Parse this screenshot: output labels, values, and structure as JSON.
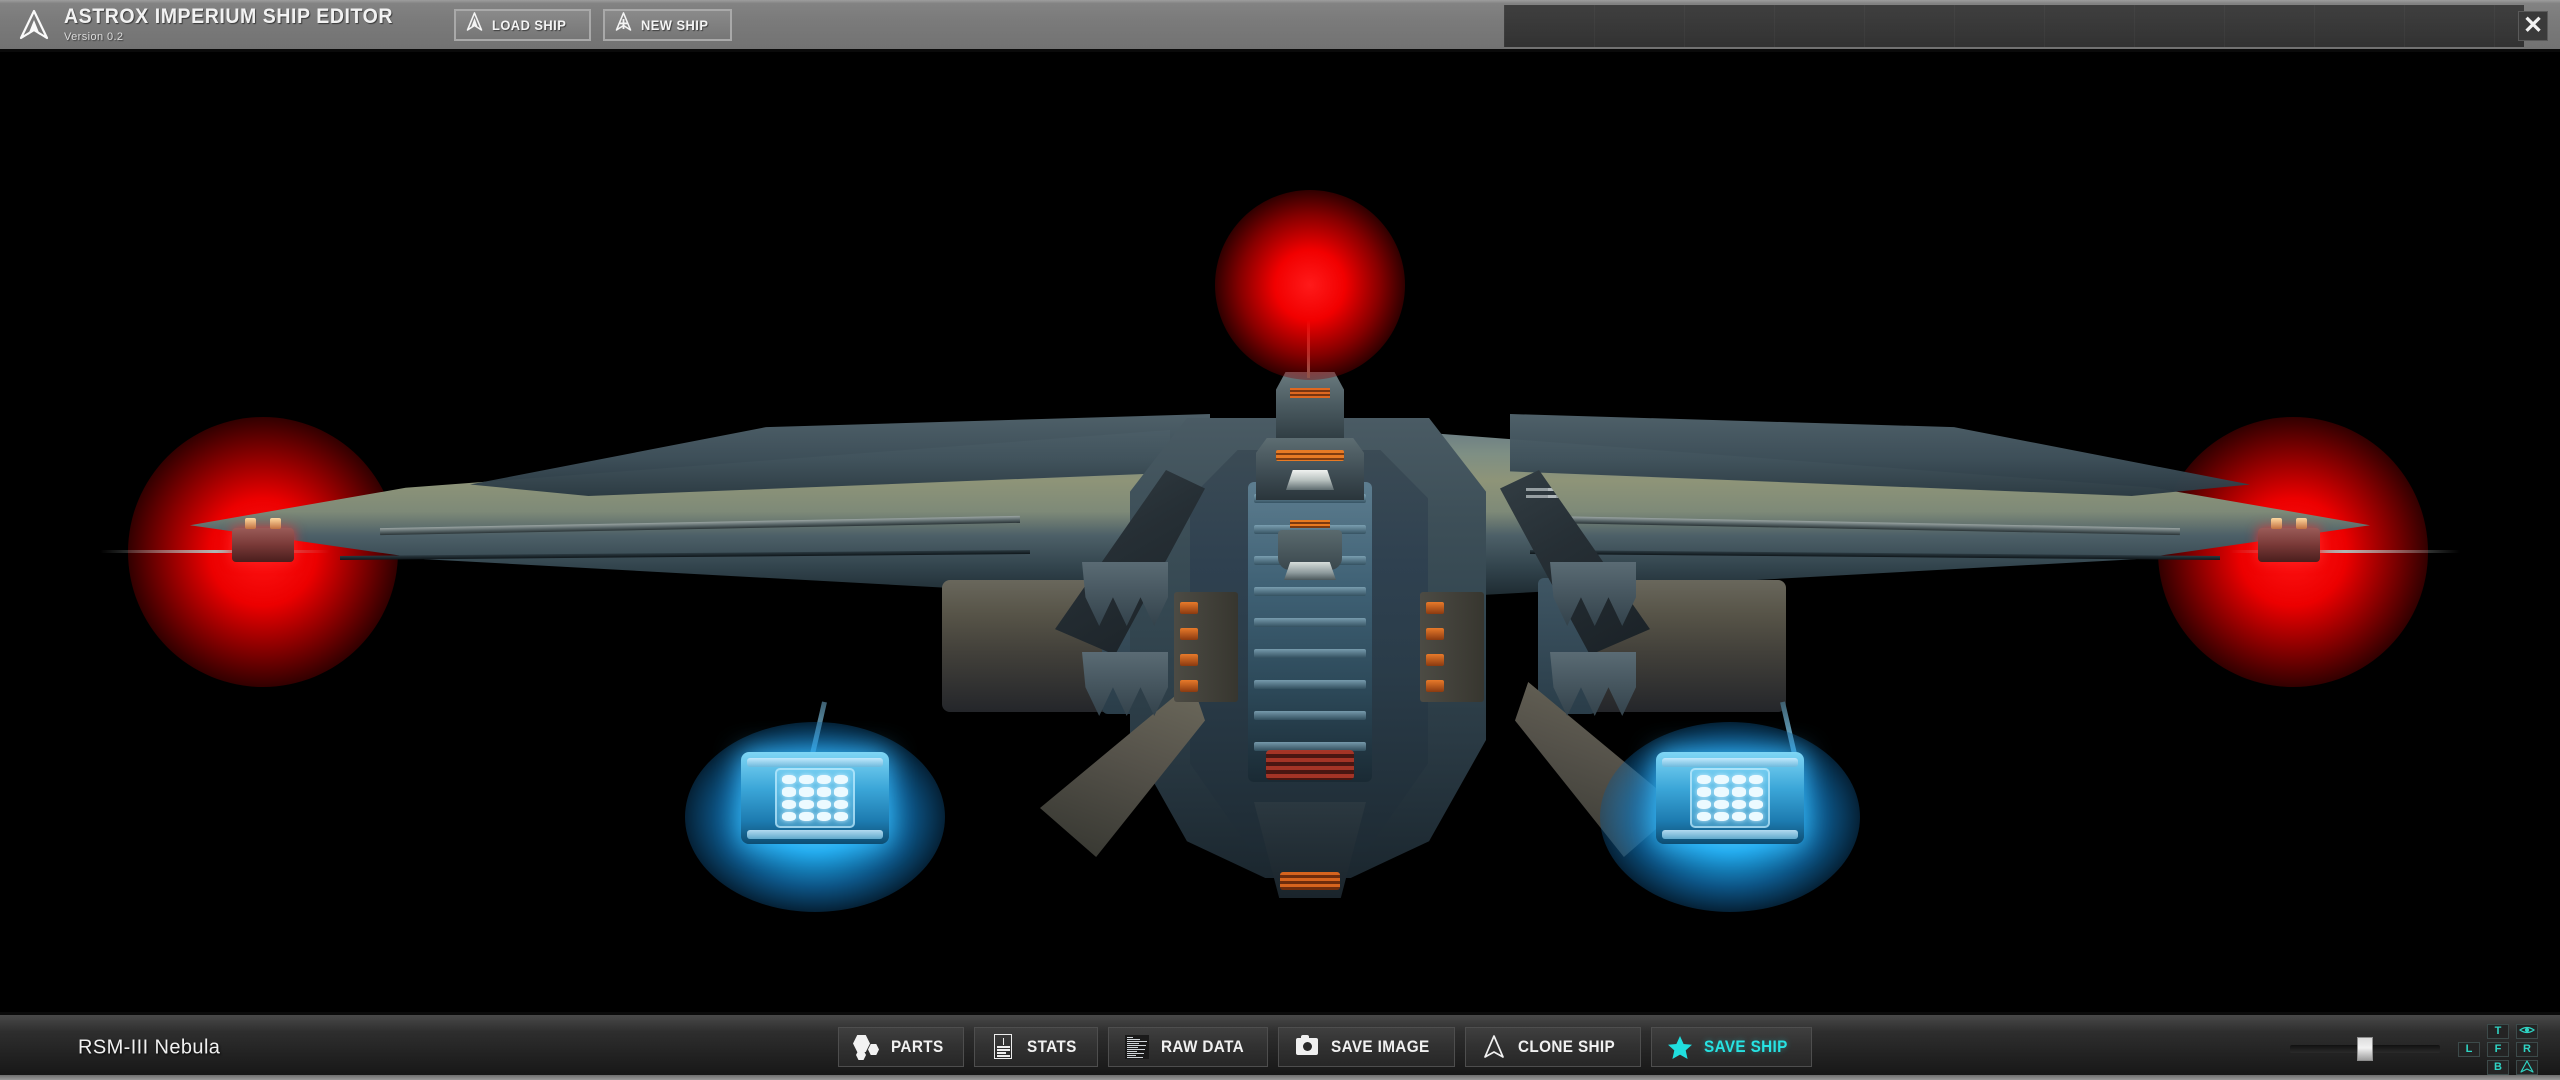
{
  "header": {
    "logo_icon": "astrox-arrow-logo-icon",
    "title": "ASTROX IMPERIUM SHIP EDITOR",
    "version": "Version 0.2",
    "buttons": [
      {
        "label": "LOAD SHIP",
        "icon": "arrow-up-outline-icon"
      },
      {
        "label": "NEW SHIP",
        "icon": "arrow-up-plus-icon"
      }
    ],
    "close_label": "✕"
  },
  "viewport": {
    "background_color": "#000000",
    "model_name": "RSM-III Nebula",
    "lights": {
      "red_glow_color": "#ec0000",
      "blue_thruster_color": "#1ea6e8",
      "red_glow_count": 3,
      "blue_glow_count": 2
    },
    "hull_colors": {
      "wing_upper": "#8e9478",
      "wing_lower": "#1b272d",
      "core": "#334650",
      "accent_orange": "#e87a24",
      "accent_blue": "#3f6175"
    }
  },
  "footer": {
    "ship_name": "RSM-III Nebula",
    "actions": [
      {
        "label": "PARTS",
        "icon": "hexagons-icon",
        "accent": false
      },
      {
        "label": "STATS",
        "icon": "document-info-icon",
        "accent": false
      },
      {
        "label": "RAW DATA",
        "icon": "text-block-icon",
        "accent": false
      },
      {
        "label": "SAVE IMAGE",
        "icon": "camera-icon",
        "accent": false
      },
      {
        "label": "CLONE SHIP",
        "icon": "arrow-up-outline-icon",
        "accent": false
      },
      {
        "label": "SAVE SHIP",
        "icon": "star-icon",
        "accent": true
      }
    ],
    "accent_color": "#27e3e3",
    "zoom_slider": {
      "label": "zoom-slider",
      "value_percent": 50,
      "min": 0,
      "max": 100
    },
    "view_buttons": [
      {
        "key": "top",
        "label": "T",
        "icon": null
      },
      {
        "key": "ortho",
        "label": "",
        "icon": "eye-icon"
      },
      {
        "key": "left",
        "label": "L",
        "icon": null
      },
      {
        "key": "front",
        "label": "F",
        "icon": null
      },
      {
        "key": "right",
        "label": "R",
        "icon": null
      },
      {
        "key": "bottom",
        "label": "B",
        "icon": null
      },
      {
        "key": "reset",
        "label": "",
        "icon": "ship-arrow-icon"
      }
    ],
    "view_button_color": "#2fd4c4"
  }
}
